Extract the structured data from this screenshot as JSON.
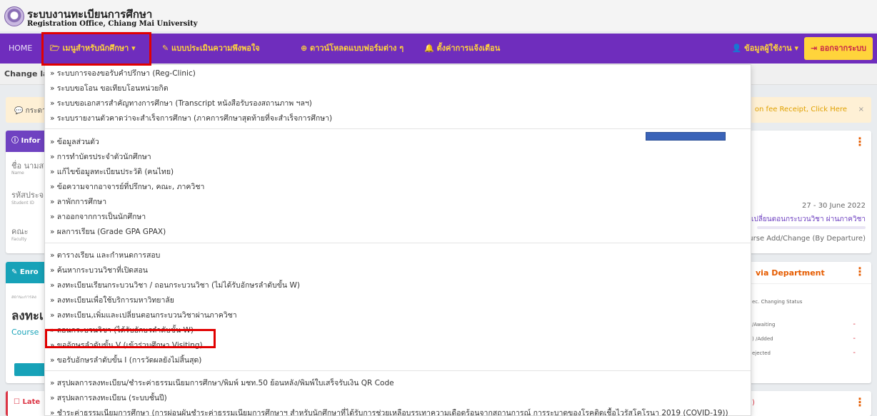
{
  "header": {
    "title_th": "ระบบงานทะเบียนการศึกษา",
    "title_en": "Registration Office, Chiang Mai University"
  },
  "nav": {
    "home": "HOME",
    "student_menu": "เมนูสำหรับนักศึกษา",
    "evaluation": "แบบประเมินความพึงพอใจ",
    "download": "ดาวน์โหลดแบบฟอร์มต่าง ๆ",
    "notification": "ตั้งค่าการแจ้งเตือน",
    "user_info": "ข้อมูลผู้ใช้งาน",
    "logout": "ออกจากระบบ"
  },
  "subbar": {
    "change": "Change la"
  },
  "alert": {
    "left": "กระดา",
    "right": "on fee Receipt, Click Here",
    "close": "×"
  },
  "left_cards": {
    "info": {
      "head": "Infor",
      "name_th": "ชื่อ นามส",
      "name_en": "Name",
      "sid_th": "รหัสประจ",
      "sid_en": "Student ID",
      "fac_th": "คณะ",
      "fac_en": "Faculty"
    },
    "enroll": {
      "head": "Enro",
      "small": "สถานะการลง",
      "big": "ลงทะเ",
      "course": "Course"
    },
    "late": {
      "head": "Late"
    }
  },
  "right_cards": {
    "top": {
      "dates": "27 - 30 June 2022",
      "th_line": "เปลี่ยนตอนกระบวนวิชา ผ่านภาควิชา",
      "en_line": "Course Add/Change (By Departure)"
    },
    "dept": {
      "head": "via Department",
      "status": "ec. Changing Status",
      "rows": [
        {
          "label": "/Awaiting",
          "value": "-"
        },
        {
          "label": ") /Added",
          "value": "-"
        },
        {
          "label": "ejected",
          "value": "-"
        }
      ]
    },
    "bottom": {
      "frag": ")"
    }
  },
  "dropdown": {
    "groups": [
      [
        "» ระบบการจองขอรับคำปรึกษา (Reg-Clinic)",
        "» ระบบขอโอน ขอเทียบโอนหน่วยกิต",
        "» ระบบขอเอกสารสำคัญทางการศึกษา (Transcript หนังสือรับรองสถานภาพ ฯลฯ)",
        "» ระบบรายงานตัวคาดว่าจะสำเร็จการศึกษา (ภาคการศึกษาสุดท้ายที่จะสำเร็จการศึกษา)"
      ],
      [
        "» ข้อมูลส่วนตัว",
        "» การทำบัตรประจำตัวนักศึกษา",
        "» แก้ไขข้อมูลทะเบียนประวัติ (คนไทย)",
        "» ข้อความจากอาจารย์ที่ปรึกษา, คณะ, ภาควิชา",
        "» ลาพักการศึกษา",
        "» ลาออกจากการเป็นนักศึกษา",
        "» ผลการเรียน (Grade GPA GPAX)"
      ],
      [
        "» ตารางเรียน และกำหนดการสอบ",
        "» ค้นหากระบวนวิชาที่เปิดสอน",
        "» ลงทะเบียนเรียนกระบวนวิชา / ถอนกระบวนวิชา (ไม่ได้รับอักษรลำดับขั้น W)",
        "» ลงทะเบียนเพื่อใช้บริการมหาวิทยาลัย",
        "» ลงทะเบียน,เพิ่มและเปลี่ยนตอนกระบวนวิชาผ่านภาควิชา",
        "» ถอนกระบวนวิชา (ได้รับอักษรลำดับขั้น W)",
        "» ขออักษรลำดับขั้น V (เข้าร่วมศึกษา Visiting)",
        "» ขอรับอักษรลำดับขั้น I (การวัดผลยังไม่สิ้นสุด)"
      ],
      [
        "» สรุปผลการลงทะเบียน/ชำระค่าธรรมเนียมการศึกษา/พิมพ์ มชท.50 ย้อนหลัง/พิมพ์ใบเสร็จรับเงิน QR Code",
        "» สรุปผลการลงทะเบียน (ระบบชั้นปี)",
        "» ชำระค่าธรรมเนียมการศึกษา (การผ่อนผันชำระค่าธรรมเนียมการศึกษาฯ สำหรับนักศึกษาที่ได้รับการช่วยเหลือบรรเทาความเดือดร้อนจากสถานการณ์ การระบาดของโรคติดเชื้อไวรัสโคโรนา 2019 (COVID-19))"
      ]
    ]
  },
  "colors": {
    "nav_bg": "#6f2dbd",
    "nav_text": "#ffd43b",
    "highlight": "#e10000"
  }
}
